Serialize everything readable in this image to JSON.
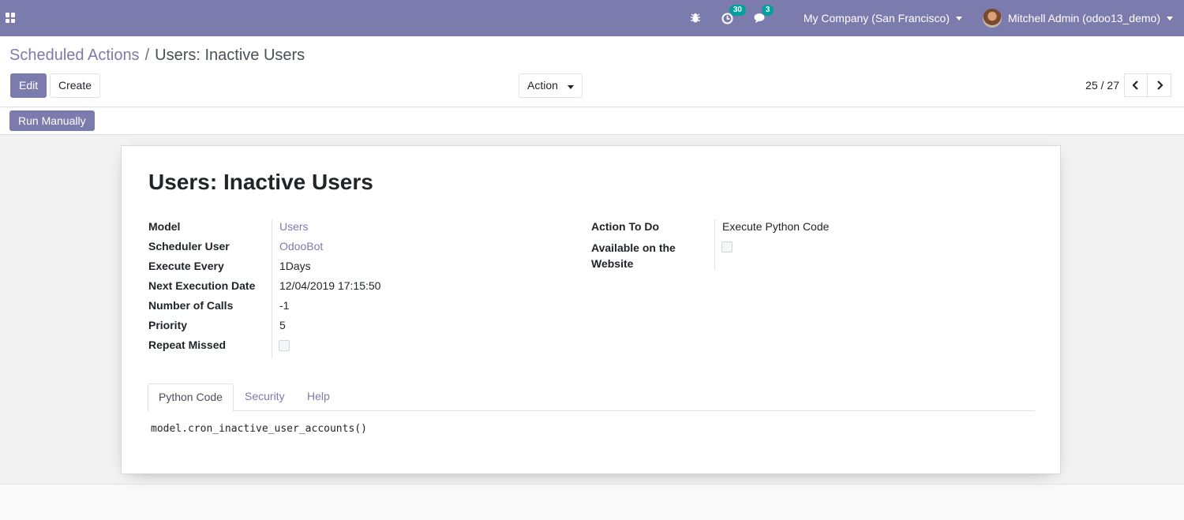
{
  "navbar": {
    "activity_count": "30",
    "messages_count": "3",
    "company": "My Company (San Francisco)",
    "user": "Mitchell Admin (odoo13_demo)"
  },
  "breadcrumb": {
    "parent": "Scheduled Actions",
    "separator": "/",
    "current": "Users: Inactive Users"
  },
  "buttons": {
    "edit": "Edit",
    "create": "Create",
    "action": "Action",
    "run_manually": "Run Manually"
  },
  "pager": {
    "value": "25 / 27"
  },
  "record": {
    "title": "Users: Inactive Users",
    "fields_left": [
      {
        "label": "Model",
        "value": "Users"
      },
      {
        "label": "Scheduler User",
        "value": "OdooBot"
      },
      {
        "label": "Execute Every",
        "value": "1Days"
      },
      {
        "label": "Next Execution Date",
        "value": "12/04/2019 17:15:50"
      },
      {
        "label": "Number of Calls",
        "value": "-1"
      },
      {
        "label": "Priority",
        "value": "5"
      },
      {
        "label": "Repeat Missed",
        "value": ""
      }
    ],
    "fields_right": [
      {
        "label": "Action To Do",
        "value": "Execute Python Code"
      },
      {
        "label": "Available on the Website",
        "value": ""
      }
    ],
    "repeat_missed_checked": false,
    "website_checked": false
  },
  "tabs": [
    {
      "label": "Python Code"
    },
    {
      "label": "Security"
    },
    {
      "label": "Help"
    }
  ],
  "code": "model.cron_inactive_user_accounts()",
  "colors": {
    "brand": "#7c7bad",
    "badge": "#00a09d"
  }
}
